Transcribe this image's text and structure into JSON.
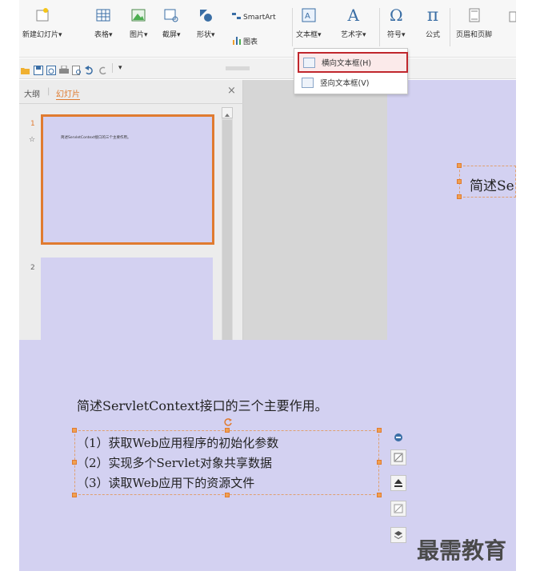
{
  "ribbon": {
    "new_slide": "新建幻灯片",
    "table": "表格",
    "picture": "图片",
    "screenshot": "截屏",
    "shape": "形状",
    "smartart": "SmartArt",
    "chart": "图表",
    "textbox": "文本框",
    "wordart": "艺术字",
    "symbol": "符号",
    "formula": "公式",
    "header_footer": "页眉和页脚",
    "symbol_glyph": "Ω",
    "formula_glyph": "π",
    "wordart_glyph": "A",
    "dropdown_caret": "▾"
  },
  "textbox_menu": {
    "horizontal": "横向文本框(H)",
    "vertical": "竖向文本框(V)"
  },
  "panel": {
    "tab_outline": "大纲",
    "tab_divider": "|",
    "tab_slides": "幻灯片",
    "close": "×",
    "slide1_number": "1",
    "slide1_star": "☆",
    "slide1_thumb_text": "简述ServletContext接口的三个主要作用。",
    "slide2_number": "2"
  },
  "slide_right": {
    "title_partial": "简述Se"
  },
  "slide_content": {
    "question": "简述ServletContext接口的三个主要作用。",
    "lines": [
      "（1）获取Web应用程序的初始化参数",
      "（2）实现多个Servlet对象共享数据",
      "（3）读取Web应用下的资源文件"
    ]
  },
  "watermark": "最需教育",
  "colors": {
    "slide_bg": "#d3d1f1",
    "accent_orange": "#e07b30",
    "menu_highlight_border": "#c0272d"
  }
}
